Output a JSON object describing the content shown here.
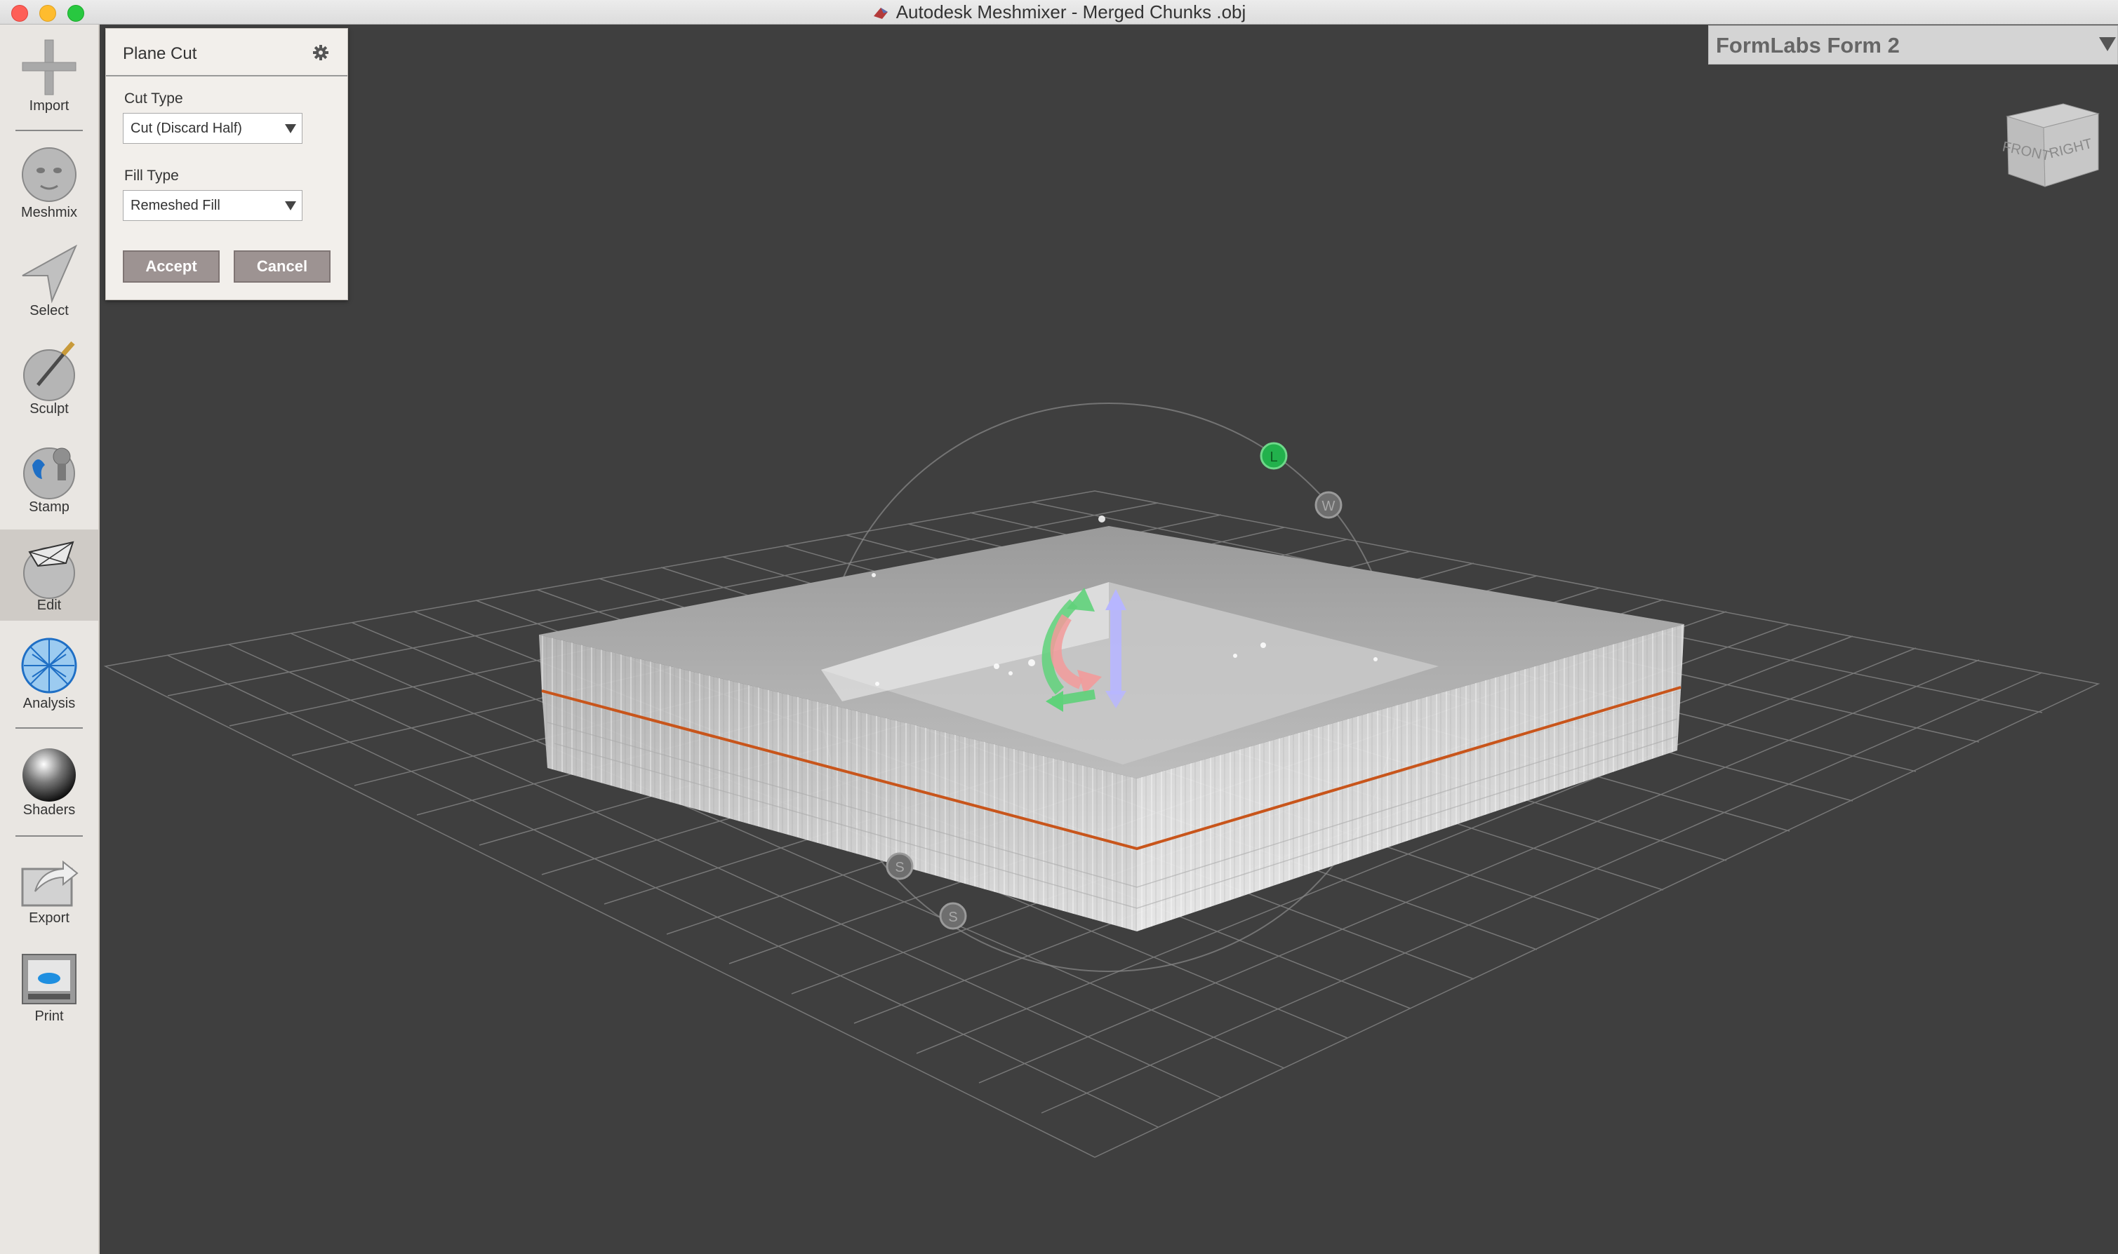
{
  "window": {
    "title": "Autodesk Meshmixer - Merged Chunks .obj"
  },
  "toolbar": {
    "tools": [
      {
        "label": "Import",
        "icon": "plus-icon"
      },
      {
        "label": "Meshmix",
        "icon": "bunny-head-icon"
      },
      {
        "label": "Select",
        "icon": "select-arrow-icon"
      },
      {
        "label": "Sculpt",
        "icon": "brush-sphere-icon"
      },
      {
        "label": "Stamp",
        "icon": "stamp-sphere-icon"
      },
      {
        "label": "Edit",
        "icon": "edit-sphere-icon",
        "active": true
      },
      {
        "label": "Analysis",
        "icon": "mesh-sphere-icon"
      },
      {
        "label": "Shaders",
        "icon": "chrome-sphere-icon"
      },
      {
        "label": "Export",
        "icon": "export-icon"
      },
      {
        "label": "Print",
        "icon": "printer-icon"
      }
    ]
  },
  "panel": {
    "title": "Plane Cut",
    "cut_type_label": "Cut Type",
    "cut_type_value": "Cut (Discard Half)",
    "fill_type_label": "Fill Type",
    "fill_type_value": "Remeshed Fill",
    "accept_label": "Accept",
    "cancel_label": "Cancel"
  },
  "printer": {
    "selected": "FormLabs Form 2"
  },
  "viewcube": {
    "front": "FRONT",
    "right": "RIGHT"
  },
  "gizmo": {
    "handle_top": "L",
    "handle_w": "W",
    "handle_s1": "S",
    "handle_s2": "S"
  },
  "colors": {
    "viewport_bg": "#3f3f3f",
    "cut_line": "#c8551b",
    "accent_green": "#22b14c"
  }
}
